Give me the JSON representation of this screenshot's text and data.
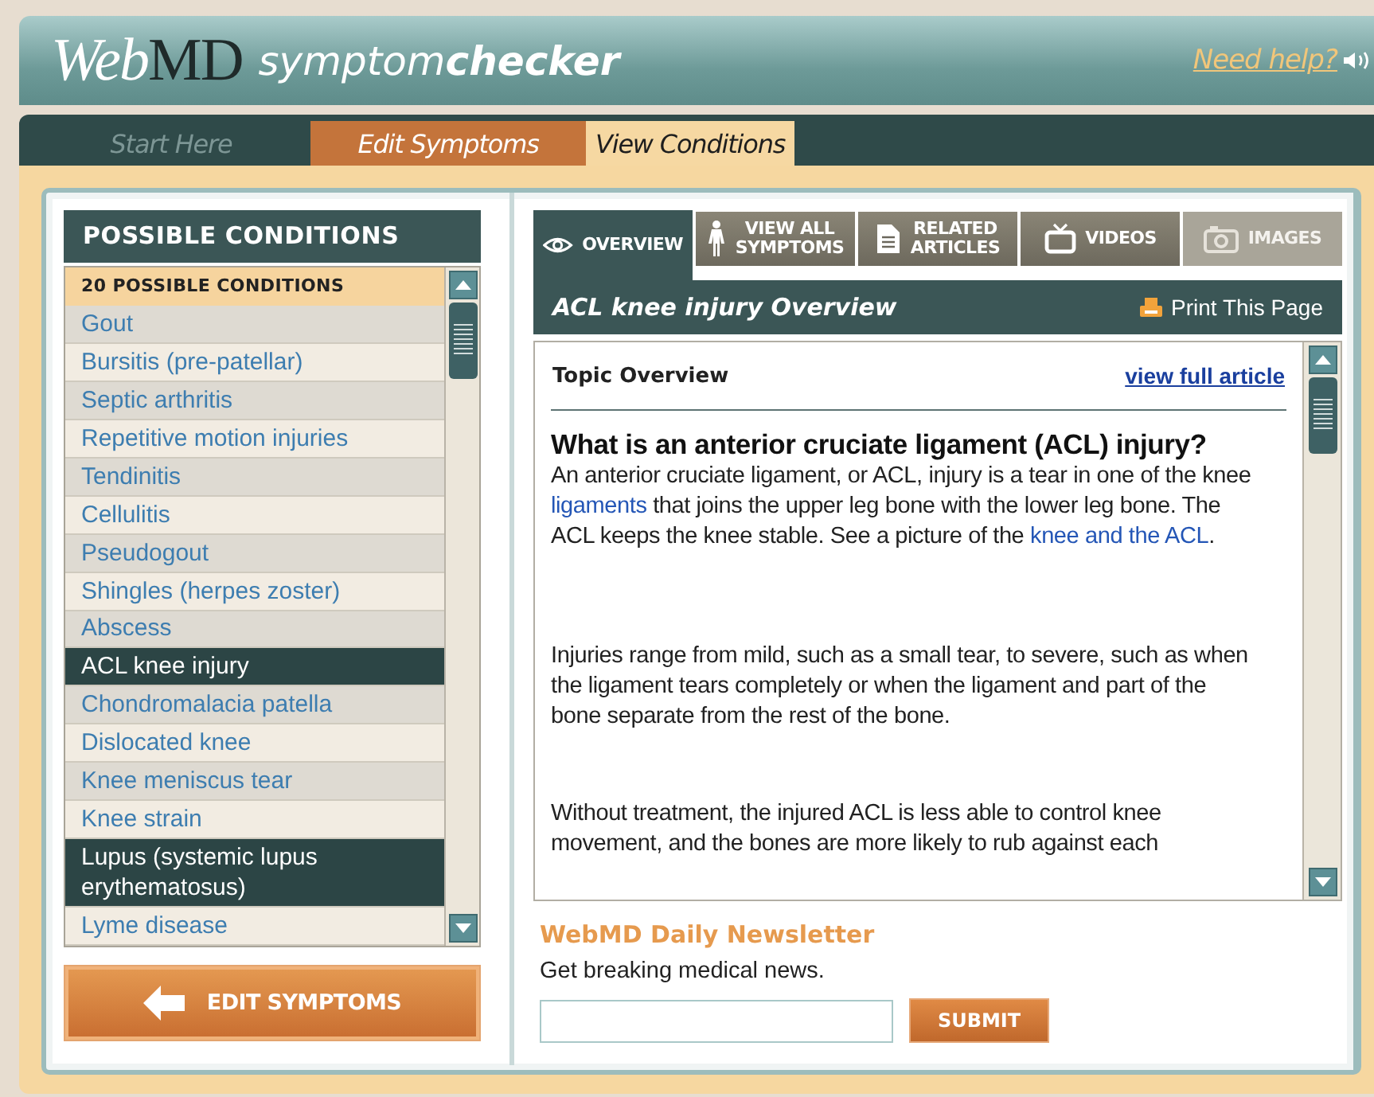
{
  "header": {
    "logo": "Web**MD**",
    "app_name": "symptom**checker**",
    "help_link": "Need help?"
  },
  "steps": [
    {
      "label": "Start Here",
      "selected": false,
      "disabled": true
    },
    {
      "label": "Edit Symptoms",
      "selected": false,
      "disabled": false
    },
    {
      "label": "View Conditions",
      "selected": true,
      "disabled": false
    }
  ],
  "conditions": {
    "title": "POSSIBLE CONDITIONS",
    "count_label": "20 POSSIBLE CONDITIONS",
    "items": [
      {
        "name": "Gout",
        "selected": false
      },
      {
        "name": "Bursitis (pre-patellar)",
        "selected": false
      },
      {
        "name": "Septic arthritis",
        "selected": false
      },
      {
        "name": "Repetitive motion injuries",
        "selected": false
      },
      {
        "name": "Tendinitis",
        "selected": false
      },
      {
        "name": "Cellulitis",
        "selected": false
      },
      {
        "name": "Pseudogout",
        "selected": false
      },
      {
        "name": "Shingles (herpes zoster)",
        "selected": false
      },
      {
        "name": "Abscess",
        "selected": false
      },
      {
        "name": "ACL knee injury",
        "selected": true
      },
      {
        "name": "Chondromalacia patella",
        "selected": false
      },
      {
        "name": "Dislocated knee",
        "selected": false
      },
      {
        "name": "Knee meniscus tear",
        "selected": false
      },
      {
        "name": "Knee strain",
        "selected": false
      },
      {
        "name": "Lupus (systemic lupus erythematosus)",
        "selected": true
      },
      {
        "name": "Lyme disease",
        "selected": false
      }
    ],
    "edit_button": "EDIT SYMPTOMS"
  },
  "article_tabs": [
    {
      "label": "OVERVIEW",
      "selected": true,
      "disabled": false
    },
    {
      "label": "VIEW ALL\nSYMPTOMS",
      "selected": false,
      "disabled": false
    },
    {
      "label": "RELATED\nARTICLES",
      "selected": false,
      "disabled": false
    },
    {
      "label": "VIDEOS",
      "selected": false,
      "disabled": false
    },
    {
      "label": "IMAGES",
      "selected": false,
      "disabled": true
    }
  ],
  "article": {
    "title": "ACL knee injury Overview",
    "print_link": "Print This Page",
    "section_title": "Topic Overview",
    "full_article_link": "view full article",
    "heading": "What is an anterior cruciate ligament (ACL) injury?",
    "paragraphs": [
      [
        {
          "kind": "text",
          "text": "An anterior cruciate ligament, or ACL, injury is a tear in one of the knee "
        },
        {
          "kind": "link",
          "text": "ligaments"
        },
        {
          "kind": "text",
          "text": " that joins the upper leg bone with the lower leg bone. The ACL keeps the knee stable. See a picture of the "
        },
        {
          "kind": "link",
          "text": "knee and the ACL"
        },
        {
          "kind": "text",
          "text": "."
        }
      ],
      [
        {
          "kind": "text",
          "text": "Injuries range from mild, such as a small tear, to severe, such as when the ligament tears completely or when the ligament and part of the bone separate from the rest of the bone."
        }
      ],
      [
        {
          "kind": "text",
          "text": "Without treatment, the injured ACL is less able to control knee movement, and the bones are more likely to rub against each"
        }
      ]
    ]
  },
  "newsletter": {
    "title": "WebMD Daily Newsletter",
    "text": "Get breaking medical news.",
    "button": "SUBMIT"
  }
}
